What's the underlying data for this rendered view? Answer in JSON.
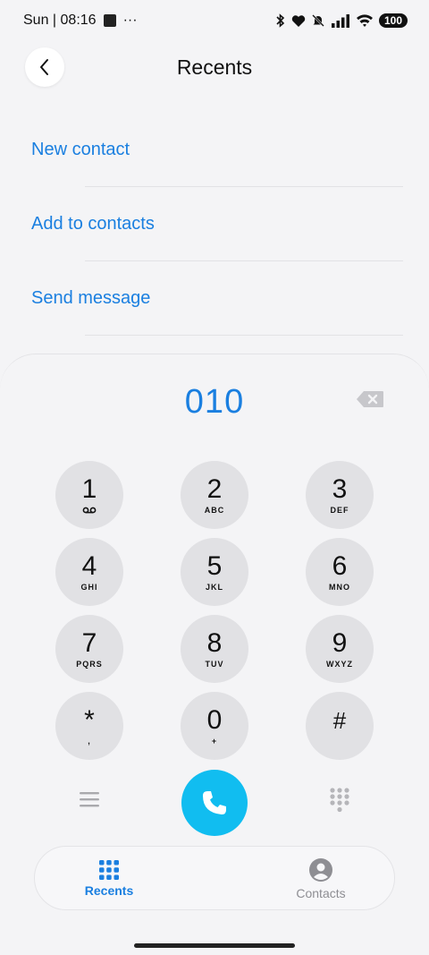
{
  "status_bar": {
    "time": "Sun | 08:16",
    "dots": "···",
    "battery": "100"
  },
  "header": {
    "title": "Recents",
    "back_icon": "chevron-left-icon"
  },
  "actions": [
    {
      "label": "New contact"
    },
    {
      "label": "Add to contacts"
    },
    {
      "label": "Send message"
    }
  ],
  "dialer": {
    "number": "010",
    "keys": [
      {
        "digit": "1",
        "letters": "voicemail"
      },
      {
        "digit": "2",
        "letters": "ABC"
      },
      {
        "digit": "3",
        "letters": "DEF"
      },
      {
        "digit": "4",
        "letters": "GHI"
      },
      {
        "digit": "5",
        "letters": "JKL"
      },
      {
        "digit": "6",
        "letters": "MNO"
      },
      {
        "digit": "7",
        "letters": "PQRS"
      },
      {
        "digit": "8",
        "letters": "TUV"
      },
      {
        "digit": "9",
        "letters": "WXYZ"
      },
      {
        "digit": "*",
        "letters": ","
      },
      {
        "digit": "0",
        "letters": "+"
      },
      {
        "digit": "#",
        "letters": ""
      }
    ]
  },
  "tabs": [
    {
      "label": "Recents",
      "active": true
    },
    {
      "label": "Contacts",
      "active": false
    }
  ],
  "colors": {
    "accent": "#1a7fe0",
    "call": "#11bdf0",
    "key_bg": "#e1e1e4",
    "background": "#f4f4f6"
  }
}
